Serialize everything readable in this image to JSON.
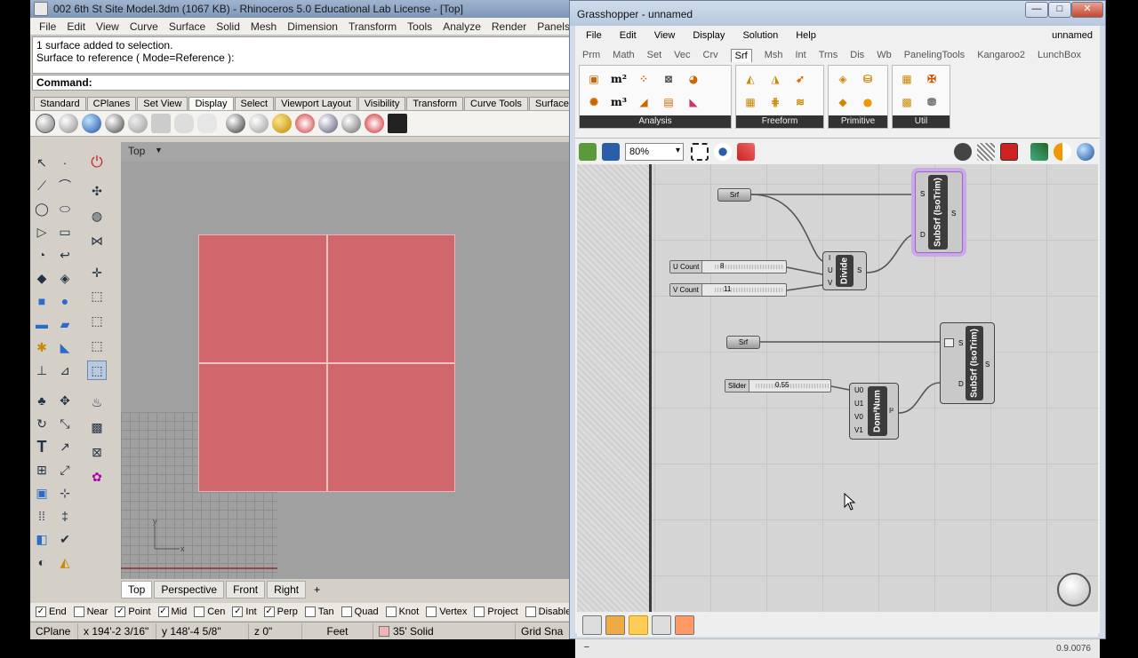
{
  "rhino": {
    "title": "002 6th St Site Model.3dm (1067 KB) - Rhinoceros 5.0 Educational Lab License - [Top]",
    "menu": [
      "File",
      "Edit",
      "View",
      "Curve",
      "Surface",
      "Solid",
      "Mesh",
      "Dimension",
      "Transform",
      "Tools",
      "Analyze",
      "Render",
      "Panels",
      "Pa"
    ],
    "history": [
      "1 surface added to selection.",
      "Surface to reference ( Mode=Reference ):"
    ],
    "command_label": "Command:",
    "toolbar_tabs": [
      "Standard",
      "CPlanes",
      "Set View",
      "Display",
      "Select",
      "Viewport Layout",
      "Visibility",
      "Transform",
      "Curve Tools",
      "Surface To"
    ],
    "active_toolbar_tab": "Display",
    "viewport_name": "Top",
    "view_tabs": [
      "Top",
      "Perspective",
      "Front",
      "Right"
    ],
    "add_view": "+",
    "axis_y": "y",
    "axis_x": "x",
    "osnaps": [
      {
        "label": "End",
        "checked": true
      },
      {
        "label": "Near",
        "checked": false
      },
      {
        "label": "Point",
        "checked": true
      },
      {
        "label": "Mid",
        "checked": true
      },
      {
        "label": "Cen",
        "checked": false
      },
      {
        "label": "Int",
        "checked": true
      },
      {
        "label": "Perp",
        "checked": true
      },
      {
        "label": "Tan",
        "checked": false
      },
      {
        "label": "Quad",
        "checked": false
      },
      {
        "label": "Knot",
        "checked": false
      },
      {
        "label": "Vertex",
        "checked": false
      },
      {
        "label": "Project",
        "checked": false
      },
      {
        "label": "Disable",
        "checked": false
      }
    ],
    "status": {
      "cplane": "CPlane",
      "x": "x 194'-2 3/16\"",
      "y": "y 148'-4 5/8\"",
      "z": "z 0\"",
      "units": "Feet",
      "layer": "35' Solid",
      "grid_snap": "Grid Sna"
    },
    "colors": {
      "surface": "#d0676d",
      "layer_swatch": "#f0b4b8"
    }
  },
  "gh": {
    "title": "Grasshopper - unnamed",
    "win_buttons": {
      "minimize": "—",
      "maximize": "□",
      "close": "✕"
    },
    "menu": [
      "File",
      "Edit",
      "View",
      "Display",
      "Solution",
      "Help"
    ],
    "document_name": "unnamed",
    "tabs": [
      "Prm",
      "Math",
      "Set",
      "Vec",
      "Crv",
      "Srf",
      "Msh",
      "Int",
      "Trns",
      "Dis",
      "Wb",
      "PanelingTools",
      "Kangaroo2",
      "LunchBox"
    ],
    "active_tab": "Srf",
    "ribbon_groups": [
      {
        "label": "Analysis",
        "icons": [
          "box-analysis",
          "m2",
          "points",
          "evaluate",
          "box-move",
          "m3",
          "plane",
          "box-mesh",
          "paint",
          "brep"
        ]
      },
      {
        "label": "Freeform",
        "icons": [
          "loft",
          "extrude",
          "sweep",
          "patch",
          "network",
          "rail"
        ]
      },
      {
        "label": "Primitive",
        "icons": [
          "box",
          "cylinder",
          "plane-srf",
          "sphere"
        ]
      },
      {
        "label": "Util",
        "icons": [
          "divide-srf",
          "isotrim",
          "copy-trim",
          "brep-join"
        ]
      }
    ],
    "ribbon_text": {
      "m2": "m²",
      "m3": "m³"
    },
    "zoom": "80%",
    "version": "0.9.0076",
    "bottom_dash": "–",
    "nodes": {
      "srf1": "Srf",
      "srf2": "Srf",
      "u_count": {
        "name": "U Count",
        "value": "8"
      },
      "v_count": {
        "name": "V Count",
        "value": "11"
      },
      "slider": {
        "name": "Slider",
        "value": "0.55"
      },
      "divide": {
        "name": "Divide",
        "inputs": [
          "I",
          "U",
          "V"
        ],
        "output": "S"
      },
      "subsrf1": {
        "name": "SubSrf (IsoTrim)",
        "inputs": [
          "S",
          "D"
        ],
        "output": "S"
      },
      "subsrf2": {
        "name": "SubSrf (IsoTrim)",
        "inputs": [
          "S",
          "D"
        ],
        "output": "S"
      },
      "dom2num": {
        "name": "Dom²Num",
        "inputs": [
          "U0",
          "U1",
          "V0",
          "V1"
        ],
        "output": "I²"
      }
    }
  }
}
